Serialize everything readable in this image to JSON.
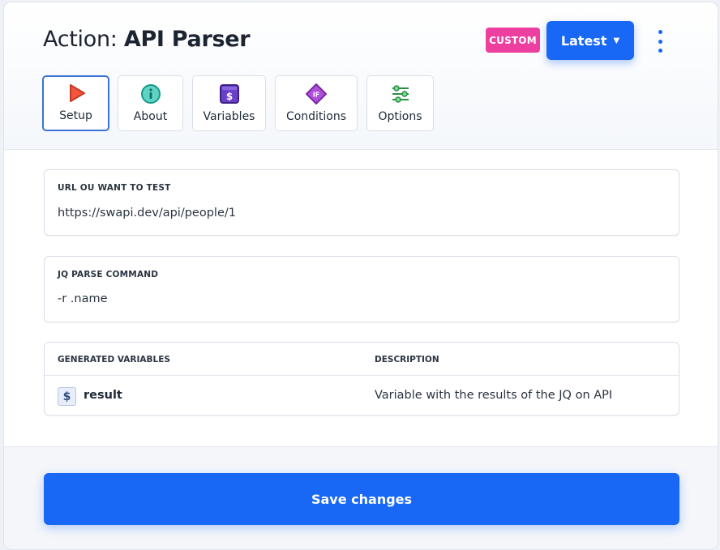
{
  "header": {
    "title_prefix": "Action: ",
    "title_name": "API Parser",
    "badge": "CUSTOM",
    "version_label": "Latest"
  },
  "tabs": [
    {
      "label": "Setup",
      "icon": "play-icon",
      "active": true
    },
    {
      "label": "About",
      "icon": "info-icon",
      "active": false
    },
    {
      "label": "Variables",
      "icon": "dollar-icon",
      "active": false
    },
    {
      "label": "Conditions",
      "icon": "if-diamond-icon",
      "active": false
    },
    {
      "label": "Options",
      "icon": "sliders-icon",
      "active": false
    }
  ],
  "fields": {
    "url": {
      "label": "URL OU WANT TO TEST",
      "value": "https://swapi.dev/api/people/1"
    },
    "jq": {
      "label": "JQ PARSE COMMAND",
      "value": "-r .name"
    }
  },
  "variables_table": {
    "columns": [
      "GENERATED VARIABLES",
      "DESCRIPTION"
    ],
    "rows": [
      {
        "badge": "$",
        "name": "result",
        "description": "Variable with the results of the JQ on API"
      }
    ]
  },
  "footer": {
    "save_label": "Save changes"
  },
  "colors": {
    "primary": "#1868f5",
    "badge_pink": "#ec3fa0",
    "active_tab_border": "#3b72d9"
  }
}
